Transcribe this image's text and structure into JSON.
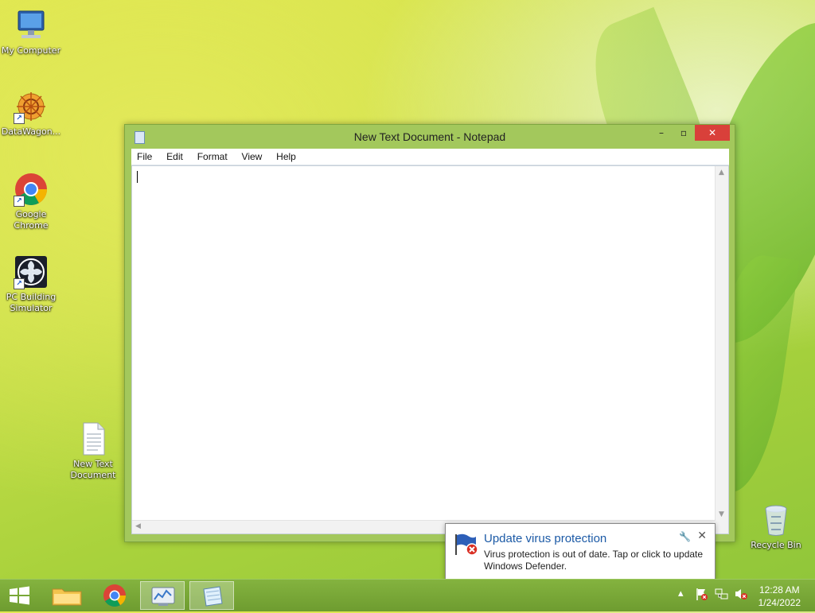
{
  "desktop": {
    "icons": [
      {
        "label": "My Computer"
      },
      {
        "label": "DataWagon..."
      },
      {
        "label": "Google Chrome"
      },
      {
        "label": "PC Building Simulator"
      },
      {
        "label": "New Text Document"
      },
      {
        "label": "Recycle Bin"
      }
    ]
  },
  "notepad": {
    "title": "New Text Document - Notepad",
    "menu": [
      "File",
      "Edit",
      "Format",
      "View",
      "Help"
    ],
    "controls": {
      "minimize": "–",
      "maximize": "▫",
      "close": "✕"
    }
  },
  "notification": {
    "title": "Update virus protection",
    "body": "Virus protection is out of date. Tap or click to update Windows Defender."
  },
  "taskbar": {
    "clock_time": "12:28 AM",
    "clock_date": "1/24/2022"
  }
}
